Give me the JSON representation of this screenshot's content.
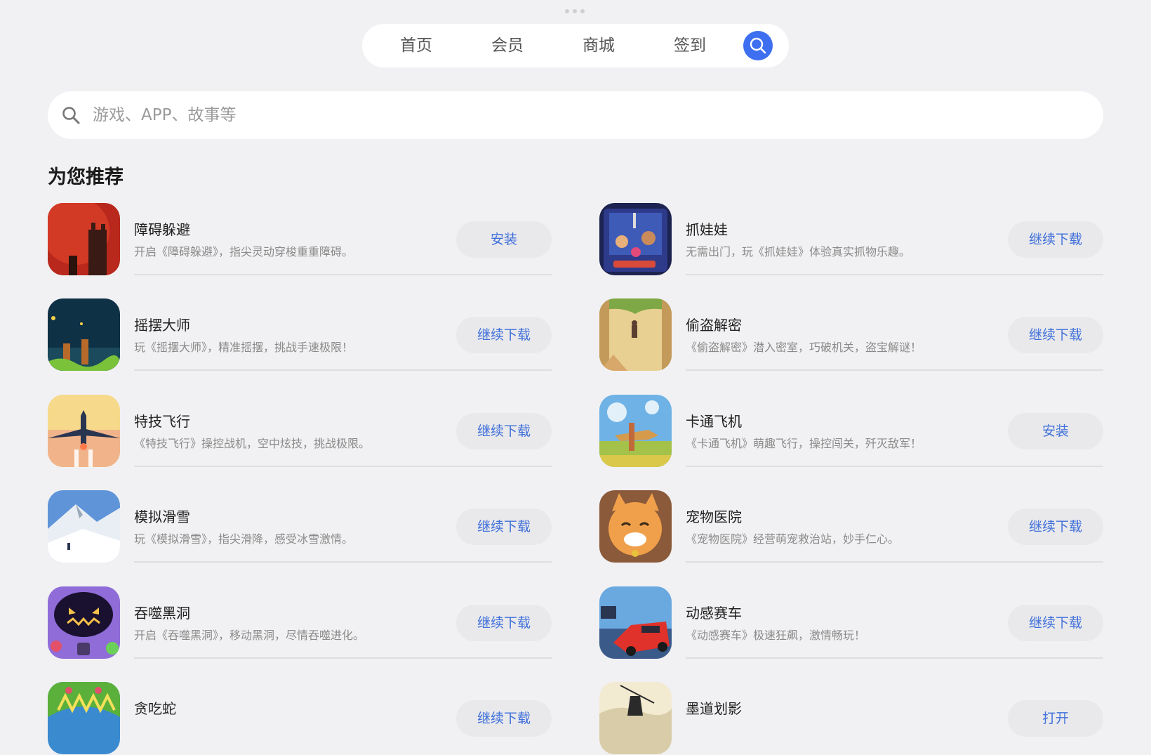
{
  "nav": {
    "tabs": [
      "首页",
      "会员",
      "商城",
      "签到"
    ],
    "search_icon": "search-icon",
    "accent": "#3d6ff0"
  },
  "search": {
    "placeholder": "游戏、APP、故事等",
    "icon": "search-icon"
  },
  "section": {
    "title": "为您推荐"
  },
  "apps": [
    {
      "name": "障碍躲避",
      "desc": "开启《障碍躲避》，指尖灵动穿梭重重障碍。",
      "button": "安装"
    },
    {
      "name": "抓娃娃",
      "desc": "无需出门，玩《抓娃娃》体验真实抓物乐趣。",
      "button": "继续下载"
    },
    {
      "name": "摇摆大师",
      "desc": "玩《摇摆大师》，精准摇摆，挑战手速极限！",
      "button": "继续下载"
    },
    {
      "name": "偷盗解密",
      "desc": "《偷盗解密》潜入密室，巧破机关，盗宝解谜！",
      "button": "继续下载"
    },
    {
      "name": "特技飞行",
      "desc": "《特技飞行》操控战机，空中炫技，挑战极限。",
      "button": "继续下载"
    },
    {
      "name": "卡通飞机",
      "desc": "《卡通飞机》萌趣飞行，操控闯关，歼灭敌军！",
      "button": "安装"
    },
    {
      "name": "模拟滑雪",
      "desc": "玩《模拟滑雪》，指尖滑降，感受冰雪激情。",
      "button": "继续下载"
    },
    {
      "name": "宠物医院",
      "desc": "《宠物医院》经营萌宠救治站，妙手仁心。",
      "button": "继续下载"
    },
    {
      "name": "吞噬黑洞",
      "desc": "开启《吞噬黑洞》，移动黑洞，尽情吞噬进化。",
      "button": "继续下载"
    },
    {
      "name": "动感赛车",
      "desc": "《动感赛车》极速狂飙，激情畅玩！",
      "button": "继续下载"
    },
    {
      "name": "贪吃蛇",
      "desc": "",
      "button": "继续下载"
    },
    {
      "name": "墨道划影",
      "desc": "",
      "button": "打开"
    }
  ]
}
